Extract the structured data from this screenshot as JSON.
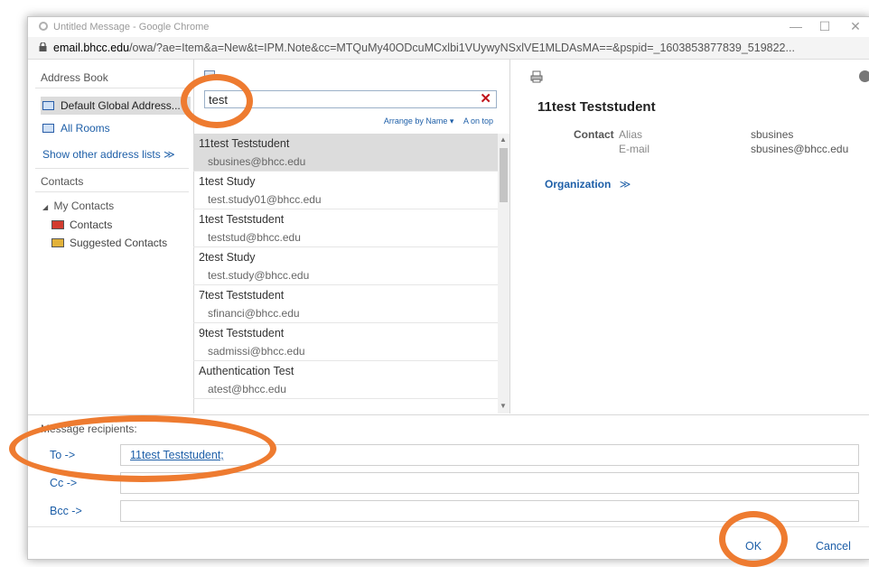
{
  "browser": {
    "title": "Untitled Message - Google Chrome",
    "url_host": "email.bhcc.edu",
    "url_rest": "/owa/?ae=Item&a=New&t=IPM.Note&cc=MTQuMy40ODcuMCxlbi1VUywyNSxlVE1MLDAsMA==&pspid=_1603853877839_519822...",
    "minimize": "—",
    "maximize": "☐",
    "close": "✕"
  },
  "left": {
    "address_book_label": "Address Book",
    "default_global": "Default Global Address...",
    "all_rooms": "All Rooms",
    "show_other": "Show other address lists ≫",
    "contacts_header": "Contacts",
    "my_contacts": "My Contacts",
    "contacts": "Contacts",
    "suggested": "Suggested Contacts"
  },
  "search": {
    "value": "test",
    "clear": "✕",
    "arrange_by": "Arrange by Name ▾",
    "order": "A on top"
  },
  "results": [
    {
      "name": "11test Teststudent",
      "email": "sbusines@bhcc.edu"
    },
    {
      "name": "1test Study",
      "email": "test.study01@bhcc.edu"
    },
    {
      "name": "1test Teststudent",
      "email": "teststud@bhcc.edu"
    },
    {
      "name": "2test Study",
      "email": "test.study@bhcc.edu"
    },
    {
      "name": "7test Teststudent",
      "email": "sfinanci@bhcc.edu"
    },
    {
      "name": "9test Teststudent",
      "email": "sadmissi@bhcc.edu"
    },
    {
      "name": "Authentication Test",
      "email": "atest@bhcc.edu"
    }
  ],
  "details": {
    "name": "11test Teststudent",
    "contact_label": "Contact",
    "alias_label": "Alias",
    "alias_value": "sbusines",
    "email_label": "E-mail",
    "email_value": "sbusines@bhcc.edu",
    "organization": "Organization",
    "org_chevron": "≫"
  },
  "recipients": {
    "header": "Message recipients:",
    "to_label": "To ->",
    "to_value": "11test Teststudent;",
    "cc_label": "Cc ->",
    "bcc_label": "Bcc ->"
  },
  "buttons": {
    "ok": "OK",
    "cancel": "Cancel"
  },
  "colors": {
    "annotation": "#ee7b30",
    "link": "#1e5fa8",
    "clear": "#c0141b"
  }
}
